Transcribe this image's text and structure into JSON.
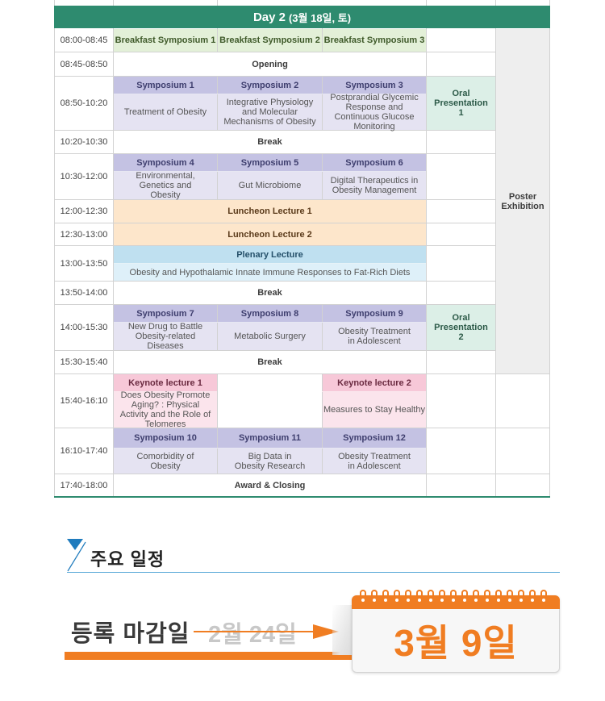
{
  "day_header": {
    "day": "Day 2",
    "date": "(3월 18일, 토)"
  },
  "times": [
    "08:00-08:45",
    "08:45-08:50",
    "08:50-10:20",
    "10:20-10:30",
    "10:30-12:00",
    "12:00-12:30",
    "12:30-13:00",
    "13:00-13:50",
    "13:50-14:00",
    "14:00-15:30",
    "15:30-15:40",
    "15:40-16:10",
    "16:10-17:40",
    "17:40-18:00"
  ],
  "breakfast": [
    "Breakfast Symposium 1",
    "Breakfast Symposium 2",
    "Breakfast Symposium 3"
  ],
  "opening": "Opening",
  "break": "Break",
  "block1": {
    "titles": [
      "Symposium 1",
      "Symposium 2",
      "Symposium 3"
    ],
    "topics": [
      "Treatment of Obesity",
      "Integrative Physiology and Molecular Mechanisms of Obesity",
      "Postprandial Glycemic Response and Continuous Glucose Monitoring"
    ]
  },
  "oral1": "Oral Presentation 1",
  "block2": {
    "titles": [
      "Symposium 4",
      "Symposium 5",
      "Symposium 6"
    ],
    "topics": [
      "Environmental, Genetics and Obesity",
      "Gut Microbiome",
      "Digital Therapeutics in Obesity Management"
    ]
  },
  "luncheon1": "Luncheon Lecture 1",
  "luncheon2": "Luncheon Lecture 2",
  "plenary": {
    "title": "Plenary Lecture",
    "topic": "Obesity and Hypothalamic Innate Immune Responses to Fat-Rich Diets"
  },
  "block3": {
    "titles": [
      "Symposium 7",
      "Symposium 8",
      "Symposium 9"
    ],
    "topics": [
      "New Drug to Battle Obesity-related Diseases",
      "Metabolic Surgery",
      "Obesity Treatment in Adolescent"
    ]
  },
  "oral2": "Oral Presentation 2",
  "keynote": {
    "titles": [
      "Keynote lecture 1",
      "Keynote lecture 2"
    ],
    "topics": [
      "Does Obesity Promote Aging? : Physical Activity and the Role of Telomeres",
      "Measures to Stay Healthy"
    ]
  },
  "block4": {
    "titles": [
      "Symposium 10",
      "Symposium 11",
      "Symposium 12"
    ],
    "topics": [
      "Comorbidity of Obesity",
      "Big Data in Obesity Research",
      "Obesity Treatment in Adolescent"
    ]
  },
  "award": "Award & Closing",
  "poster": "Poster Exhibition",
  "schedule_section": {
    "title": "주요 일정",
    "deadline_label": "등록 마감일",
    "old_date": "2월 24일",
    "new_date": "3월 9일"
  },
  "colors": {
    "header": "#2e8b6f",
    "accent": "#f07d22",
    "title_blue": "#1f7bbd"
  }
}
